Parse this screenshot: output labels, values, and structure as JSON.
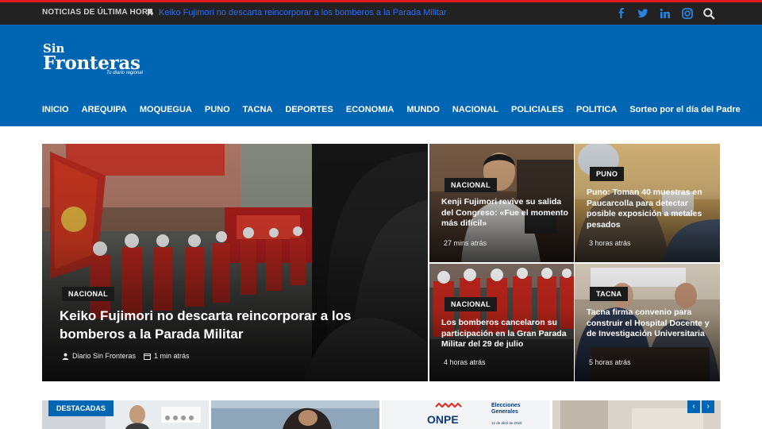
{
  "topbar": {
    "breaking_label": "NOTICIAS DE ÚLTIMA HORA",
    "breaking_headline": "Keiko Fujimori no descarta reincorporar a los bomberos a la Parada Militar",
    "social": [
      "facebook-icon",
      "twitter-icon",
      "linkedin-icon",
      "instagram-icon",
      "search-icon"
    ]
  },
  "logo": {
    "line1": "Sin",
    "line2": "Fronteras",
    "tagline": "Tu diario regional"
  },
  "nav": [
    "INICIO",
    "AREQUIPA",
    "MOQUEGUA",
    "PUNO",
    "TACNA",
    "DEPORTES",
    "ECONOMIA",
    "MUNDO",
    "NACIONAL",
    "POLICIALES",
    "POLITICA",
    "Sorteo por el día del Padre"
  ],
  "featured": {
    "category": "NACIONAL",
    "title": "Keiko Fujimori no descarta reincorporar a los bomberos a la Parada Militar",
    "author": "Diario Sin Fronteras",
    "time": "1 min atrás"
  },
  "cards": [
    {
      "category": "NACIONAL",
      "title": "Kenji Fujimori revive su salida del Congreso: «Fue el momento más difícil»",
      "time": "27 mins atrás"
    },
    {
      "category": "PUNO",
      "title": "Puno: Toman 40 muestras en Paucarcolla para detectar posible exposición a metales pesados",
      "time": "3 horas atrás"
    },
    {
      "category": "NACIONAL",
      "title": "Los bomberos cancelaron su participación en la Gran Parada Militar del 29 de julio",
      "time": "4 horas atrás"
    },
    {
      "category": "TACNA",
      "title": "Tacna firma convenio para construir el Hospital Docente y de Investigación Universitaria",
      "time": "5 horas atrás"
    }
  ],
  "bottom": {
    "label": "DESTACADAS",
    "onpe_title": "ONPE",
    "onpe_sub": "Elecciones Generales",
    "onpe_date": "12 de abril de 2026"
  },
  "colors": {
    "brand": "#0066b3",
    "topbar": "#222222",
    "accent": "#e01b1b",
    "link": "#2f6df0"
  }
}
